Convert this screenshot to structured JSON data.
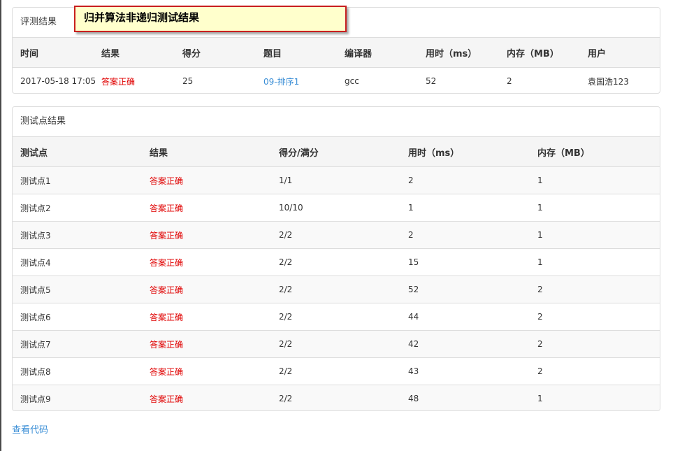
{
  "tooltip": "归并算法非递归测试结果",
  "eval_panel": {
    "title": "评测结果",
    "headers": [
      "时间",
      "结果",
      "得分",
      "题目",
      "编译器",
      "用时（ms）",
      "内存（MB）",
      "用户"
    ],
    "row": {
      "time": "2017-05-18 17:05",
      "result": "答案正确",
      "score": "25",
      "problem": "09-排序1",
      "compiler": "gcc",
      "time_ms": "52",
      "memory_mb": "2",
      "user": "袁国浩123"
    }
  },
  "testcase_panel": {
    "title": "测试点结果",
    "headers": [
      "测试点",
      "结果",
      "得分/满分",
      "用时（ms）",
      "内存（MB）"
    ],
    "rows": [
      {
        "name": "测试点1",
        "result": "答案正确",
        "score": "1/1",
        "time": "2",
        "mem": "1"
      },
      {
        "name": "测试点2",
        "result": "答案正确",
        "score": "10/10",
        "time": "1",
        "mem": "1"
      },
      {
        "name": "测试点3",
        "result": "答案正确",
        "score": "2/2",
        "time": "2",
        "mem": "1"
      },
      {
        "name": "测试点4",
        "result": "答案正确",
        "score": "2/2",
        "time": "15",
        "mem": "1"
      },
      {
        "name": "测试点5",
        "result": "答案正确",
        "score": "2/2",
        "time": "52",
        "mem": "2"
      },
      {
        "name": "测试点6",
        "result": "答案正确",
        "score": "2/2",
        "time": "44",
        "mem": "2"
      },
      {
        "name": "测试点7",
        "result": "答案正确",
        "score": "2/2",
        "time": "42",
        "mem": "2"
      },
      {
        "name": "测试点8",
        "result": "答案正确",
        "score": "2/2",
        "time": "43",
        "mem": "2"
      },
      {
        "name": "测试点9",
        "result": "答案正确",
        "score": "2/2",
        "time": "48",
        "mem": "1"
      }
    ]
  },
  "view_code_link": "查看代码",
  "colors": {
    "accepted": "#e00000",
    "link": "#3a8ed6",
    "tooltip_bg": "#ffffcc",
    "tooltip_border": "#c81e1e"
  }
}
